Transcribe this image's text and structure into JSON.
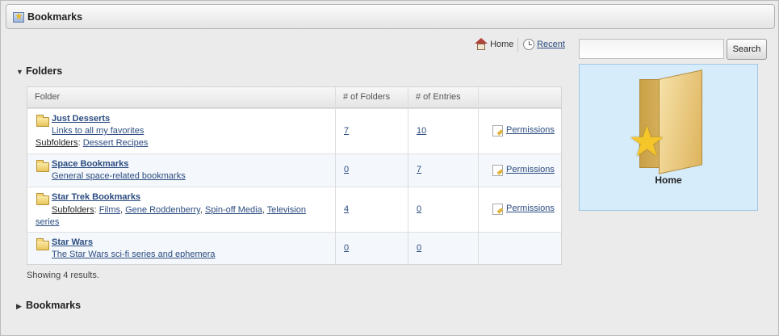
{
  "window": {
    "title": "Bookmarks"
  },
  "nav": {
    "home_label": "Home",
    "recent_label": "Recent"
  },
  "search": {
    "value": "",
    "button_label": "Search"
  },
  "folders_section": {
    "title": "Folders",
    "columns": [
      "Folder",
      "# of Folders",
      "# of Entries",
      ""
    ],
    "rows": [
      {
        "name": "Just Desserts",
        "description": "Links to all my favorites",
        "subfolders_label": "Subfolders",
        "subfolders": [
          "Dessert Recipes"
        ],
        "folders_count": "7",
        "entries_count": "10",
        "action": "Permissions"
      },
      {
        "name": "Space Bookmarks",
        "description": "General space-related bookmarks",
        "folders_count": "0",
        "entries_count": "7",
        "action": "Permissions"
      },
      {
        "name": "Star Trek Bookmarks",
        "subfolders_label": "Subfolders",
        "subfolders": [
          "Films",
          "Gene Roddenberry",
          "Spin-off Media",
          "Television series"
        ],
        "folders_count": "4",
        "entries_count": "0",
        "action": "Permissions"
      },
      {
        "name": "Star Wars",
        "description": "The Star Wars sci-fi series and ephemera",
        "folders_count": "0",
        "entries_count": "0",
        "action": ""
      }
    ],
    "results_text": "Showing 4 results."
  },
  "bookmarks_section": {
    "title": "Bookmarks"
  },
  "preview": {
    "label": "Home",
    "icon": "home-folder-star-icon"
  }
}
